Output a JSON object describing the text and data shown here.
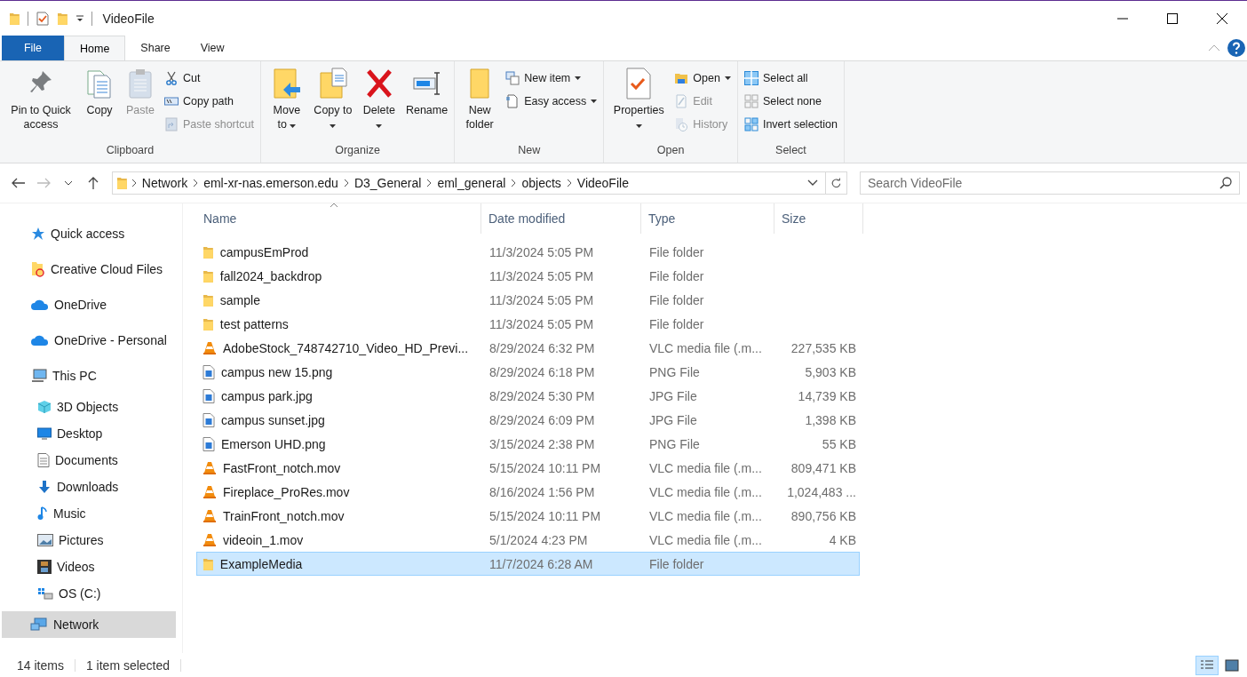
{
  "title_bar": {
    "title": "VideoFile"
  },
  "ribbon_tabs": [
    {
      "label": "File",
      "kind": "file",
      "selected": false
    },
    {
      "label": "Home",
      "kind": "tab",
      "selected": true
    },
    {
      "label": "Share",
      "kind": "tab",
      "selected": false
    },
    {
      "label": "View",
      "kind": "tab",
      "selected": false
    }
  ],
  "ribbon_groups": [
    {
      "label": "Clipboard",
      "items": [
        {
          "label": "Pin to Quick access",
          "kind": "large",
          "disabled": false,
          "dropdown": false
        },
        {
          "label": "Copy",
          "kind": "large",
          "disabled": false,
          "dropdown": false
        },
        {
          "label": "Paste",
          "kind": "large",
          "disabled": true,
          "dropdown": false
        },
        {
          "label": "Cut",
          "kind": "small",
          "disabled": false,
          "dropdown": false
        },
        {
          "label": "Copy path",
          "kind": "small",
          "disabled": false,
          "dropdown": false
        },
        {
          "label": "Paste shortcut",
          "kind": "small",
          "disabled": true,
          "dropdown": false
        }
      ]
    },
    {
      "label": "Organize",
      "items": [
        {
          "label": "Move to",
          "kind": "large",
          "disabled": false,
          "dropdown": true
        },
        {
          "label": "Copy to",
          "kind": "large",
          "disabled": false,
          "dropdown": true
        },
        {
          "label": "Delete",
          "kind": "large",
          "disabled": false,
          "dropdown": true
        },
        {
          "label": "Rename",
          "kind": "large",
          "disabled": false,
          "dropdown": false
        }
      ]
    },
    {
      "label": "New",
      "items": [
        {
          "label": "New folder",
          "kind": "large",
          "disabled": false,
          "dropdown": false
        },
        {
          "label": "New item",
          "kind": "small",
          "disabled": false,
          "dropdown": true
        },
        {
          "label": "Easy access",
          "kind": "small",
          "disabled": false,
          "dropdown": true
        }
      ]
    },
    {
      "label": "Open",
      "items": [
        {
          "label": "Properties",
          "kind": "large",
          "disabled": false,
          "dropdown": true
        },
        {
          "label": "Open",
          "kind": "small",
          "disabled": false,
          "dropdown": true
        },
        {
          "label": "Edit",
          "kind": "small",
          "disabled": true,
          "dropdown": false
        },
        {
          "label": "History",
          "kind": "small",
          "disabled": true,
          "dropdown": false
        }
      ]
    },
    {
      "label": "Select",
      "items": [
        {
          "label": "Select all",
          "kind": "small",
          "disabled": false,
          "dropdown": false
        },
        {
          "label": "Select none",
          "kind": "small",
          "disabled": false,
          "dropdown": false
        },
        {
          "label": "Invert selection",
          "kind": "small",
          "disabled": false,
          "dropdown": false
        }
      ]
    }
  ],
  "address_bar": {
    "path": [
      "Network",
      "eml-xr-nas.emerson.edu",
      "D3_General",
      "eml_general",
      "objects",
      "VideoFile"
    ]
  },
  "search": {
    "placeholder": "Search VideoFile"
  },
  "sidebar": {
    "items": [
      {
        "label": "Quick access",
        "selected": false
      },
      {
        "label": "Creative Cloud Files",
        "selected": false
      },
      {
        "label": "OneDrive",
        "selected": false
      },
      {
        "label": "OneDrive - Personal",
        "selected": false
      },
      {
        "label": "This PC",
        "selected": false,
        "children": [
          {
            "label": "3D Objects",
            "selected": false
          },
          {
            "label": "Desktop",
            "selected": false
          },
          {
            "label": "Documents",
            "selected": false
          },
          {
            "label": "Downloads",
            "selected": false
          },
          {
            "label": "Music",
            "selected": false
          },
          {
            "label": "Pictures",
            "selected": false
          },
          {
            "label": "Videos",
            "selected": false
          },
          {
            "label": "OS (C:)",
            "selected": false
          }
        ]
      },
      {
        "label": "Network",
        "selected": true
      }
    ]
  },
  "table": {
    "columns": [
      "Name",
      "Date modified",
      "Type",
      "Size"
    ],
    "rows": [
      {
        "kind": "folder",
        "name": "campusEmProd",
        "date": "11/3/2024 5:05 PM",
        "type": "File folder",
        "size": "",
        "selected": false
      },
      {
        "kind": "folder",
        "name": "fall2024_backdrop",
        "date": "11/3/2024 5:05 PM",
        "type": "File folder",
        "size": "",
        "selected": false
      },
      {
        "kind": "folder",
        "name": "sample",
        "date": "11/3/2024 5:05 PM",
        "type": "File folder",
        "size": "",
        "selected": false
      },
      {
        "kind": "folder",
        "name": "test patterns",
        "date": "11/3/2024 5:05 PM",
        "type": "File folder",
        "size": "",
        "selected": false
      },
      {
        "kind": "video",
        "name": "AdobeStock_748742710_Video_HD_Previ...",
        "date": "8/29/2024 6:32 PM",
        "type": "VLC media file (.m...",
        "size": "227,535 KB",
        "selected": false
      },
      {
        "kind": "image",
        "name": "campus new 15.png",
        "date": "8/29/2024 6:18 PM",
        "type": "PNG File",
        "size": "5,903 KB",
        "selected": false
      },
      {
        "kind": "image",
        "name": "campus park.jpg",
        "date": "8/29/2024 5:30 PM",
        "type": "JPG File",
        "size": "14,739 KB",
        "selected": false
      },
      {
        "kind": "image",
        "name": "campus sunset.jpg",
        "date": "8/29/2024 6:09 PM",
        "type": "JPG File",
        "size": "1,398 KB",
        "selected": false
      },
      {
        "kind": "image",
        "name": "Emerson UHD.png",
        "date": "3/15/2024 2:38 PM",
        "type": "PNG File",
        "size": "55 KB",
        "selected": false
      },
      {
        "kind": "video",
        "name": "FastFront_notch.mov",
        "date": "5/15/2024 10:11 PM",
        "type": "VLC media file (.m...",
        "size": "809,471 KB",
        "selected": false
      },
      {
        "kind": "video",
        "name": "Fireplace_ProRes.mov",
        "date": "8/16/2024 1:56 PM",
        "type": "VLC media file (.m...",
        "size": "1,024,483 ...",
        "selected": false
      },
      {
        "kind": "video",
        "name": "TrainFront_notch.mov",
        "date": "5/15/2024 10:11 PM",
        "type": "VLC media file (.m...",
        "size": "890,756 KB",
        "selected": false
      },
      {
        "kind": "video",
        "name": "videoin_1.mov",
        "date": "5/1/2024 4:23 PM",
        "type": "VLC media file (.m...",
        "size": "4 KB",
        "selected": false
      },
      {
        "kind": "folder",
        "name": "ExampleMedia",
        "date": "11/7/2024 6:28 AM",
        "type": "File folder",
        "size": "",
        "selected": true
      }
    ]
  },
  "status_bar": {
    "item_count": "14 items",
    "selection": "1 item selected"
  },
  "view_buttons": [
    {
      "kind": "details",
      "selected": true
    },
    {
      "kind": "large-icons",
      "selected": false
    }
  ]
}
